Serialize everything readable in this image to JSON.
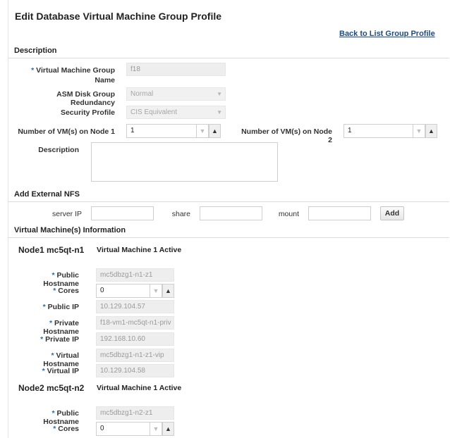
{
  "page": {
    "title": "Edit Database Virtual Machine Group Profile",
    "back_link": "Back to List Group Profile"
  },
  "description_section": {
    "heading": "Description",
    "vm_group_name": {
      "required": "*",
      "label_line1": "Virtual Machine Group",
      "label_line2": "Name",
      "value": "f18"
    },
    "asm_redundancy": {
      "label": "ASM Disk Group Redundancy",
      "value": "Normal"
    },
    "security_profile": {
      "label": "Security Profile",
      "value": "CIS Equivalent"
    },
    "vms_node1": {
      "label": "Number of VM(s) on Node 1",
      "value": "1"
    },
    "vms_node2": {
      "label": "Number of VM(s) on Node 2",
      "value": "1"
    },
    "description": {
      "label": "Description",
      "value": ""
    }
  },
  "nfs_section": {
    "heading": "Add External NFS",
    "server_ip_label": "server IP",
    "share_label": "share",
    "mount_label": "mount",
    "add_button": "Add"
  },
  "vm_info_section": {
    "heading": "Virtual Machine(s) Information",
    "nodes": [
      {
        "name": "Node1 mc5qt-n1",
        "status": "Virtual Machine 1 Active",
        "public_hostname": {
          "label": "Public Hostname",
          "value": "mc5dbzg1-n1-z1"
        },
        "cores": {
          "label": "Cores",
          "value": "0"
        },
        "public_ip": {
          "label": "Public IP",
          "value": "10.129.104.57"
        },
        "private_hostname": {
          "label": "Private Hostname",
          "value": "f18-vm1-mc5qt-n1-priv"
        },
        "private_ip": {
          "label": "Private IP",
          "value": "192.168.10.60"
        },
        "virtual_hostname": {
          "label": "Virtual Hostname",
          "value": "mc5dbzg1-n1-z1-vip"
        },
        "virtual_ip": {
          "label": "Virtual IP",
          "value": "10.129.104.58"
        }
      },
      {
        "name": "Node2 mc5qt-n2",
        "status": "Virtual Machine 1 Active",
        "public_hostname": {
          "label": "Public Hostname",
          "value": "mc5dbzg1-n2-z1"
        },
        "cores": {
          "label": "Cores",
          "value": "0"
        }
      }
    ]
  },
  "required_marker": "*",
  "icons": {
    "dropdown": "▼",
    "step_down": "▼",
    "step_up": "▲"
  },
  "colors": {
    "link": "#1a4a8c",
    "required": "#2b6cb0"
  }
}
